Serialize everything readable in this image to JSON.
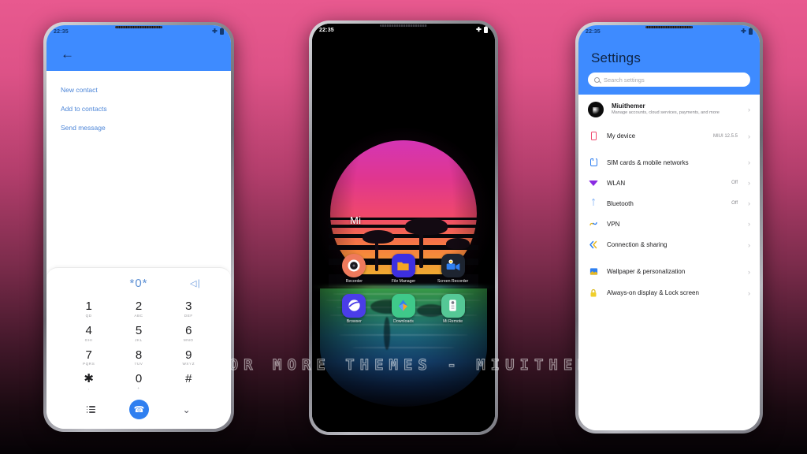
{
  "watermark": "VISIT FOR MORE THEMES - MIUITHEMER.COM",
  "colors": {
    "accent_blue": "#3e8bff",
    "call_green_blue": "#2f7ff0",
    "bg_pink": "#e8598f",
    "bg_dark": "#050205"
  },
  "status_bar": {
    "time": "22:35",
    "airplane_icon": "airplane-mode-icon",
    "battery_icon": "battery-icon"
  },
  "phone_left": {
    "app": "dialer",
    "back_icon": "back-arrow-icon",
    "suggestions": [
      {
        "label": "New contact"
      },
      {
        "label": "Add to contacts"
      },
      {
        "label": "Send message"
      }
    ],
    "entry": {
      "number": "*0*",
      "delete_icon": "backspace-icon"
    },
    "keys": [
      {
        "digit": "1",
        "letters": "QD"
      },
      {
        "digit": "2",
        "letters": "ABC"
      },
      {
        "digit": "3",
        "letters": "DEF"
      },
      {
        "digit": "4",
        "letters": "GHI"
      },
      {
        "digit": "5",
        "letters": "JKL"
      },
      {
        "digit": "6",
        "letters": "MNO"
      },
      {
        "digit": "7",
        "letters": "PQRS"
      },
      {
        "digit": "8",
        "letters": "TUV"
      },
      {
        "digit": "9",
        "letters": "WXYZ"
      },
      {
        "digit": "✱",
        "letters": ","
      },
      {
        "digit": "0",
        "letters": "+"
      },
      {
        "digit": "#",
        "letters": ""
      }
    ],
    "bottom_bar": {
      "list_icon": "contacts-list-icon",
      "call_icon": "phone-call-icon",
      "collapse_icon": "chevron-down-icon"
    }
  },
  "phone_center": {
    "app": "home-screen",
    "wallpaper_label": "Mi",
    "apps": [
      {
        "label": "Recorder",
        "icon": "recorder-icon",
        "bg": "#ef7a5c"
      },
      {
        "label": "File Manager",
        "icon": "file-manager-icon",
        "bg": "#3d2fe0"
      },
      {
        "label": "Screen Recorder",
        "icon": "screen-recorder-icon",
        "bg": "#1d2430"
      },
      {
        "label": "Browser",
        "icon": "browser-icon",
        "bg": "#4a3de8"
      },
      {
        "label": "Downloads",
        "icon": "downloads-icon",
        "bg": "#3fc98a"
      },
      {
        "label": "Mi Remote",
        "icon": "mi-remote-icon",
        "bg": "#55c896"
      }
    ]
  },
  "phone_right": {
    "app": "settings",
    "title": "Settings",
    "search": {
      "placeholder": "Search settings",
      "icon": "search-icon"
    },
    "account": {
      "name": "Miuithemer",
      "subtitle": "Manage accounts, cloud services, payments, and more",
      "avatar": "account-avatar"
    },
    "items": [
      {
        "label": "My device",
        "value": "MIUI 12.5.5",
        "icon": "device-icon",
        "color": "#f0486f"
      },
      {
        "label": "SIM cards & mobile networks",
        "value": "",
        "icon": "sim-card-icon",
        "color": "#2f7ff0"
      },
      {
        "label": "WLAN",
        "value": "Off",
        "icon": "wifi-icon",
        "color": "#8a2be2"
      },
      {
        "label": "Bluetooth",
        "value": "Off",
        "icon": "bluetooth-icon",
        "color": "#2f7ff0"
      },
      {
        "label": "VPN",
        "value": "",
        "icon": "vpn-icon",
        "color": "#e8b820"
      },
      {
        "label": "Connection & sharing",
        "value": "",
        "icon": "connection-sharing-icon",
        "color": "#2f7ff0"
      },
      {
        "label": "Wallpaper & personalization",
        "value": "",
        "icon": "wallpaper-icon",
        "color": "#2f7ff0"
      },
      {
        "label": "Always-on display & Lock screen",
        "value": "",
        "icon": "lock-icon",
        "color": "#e8c020"
      }
    ],
    "chevron_icon": "chevron-right-icon"
  }
}
